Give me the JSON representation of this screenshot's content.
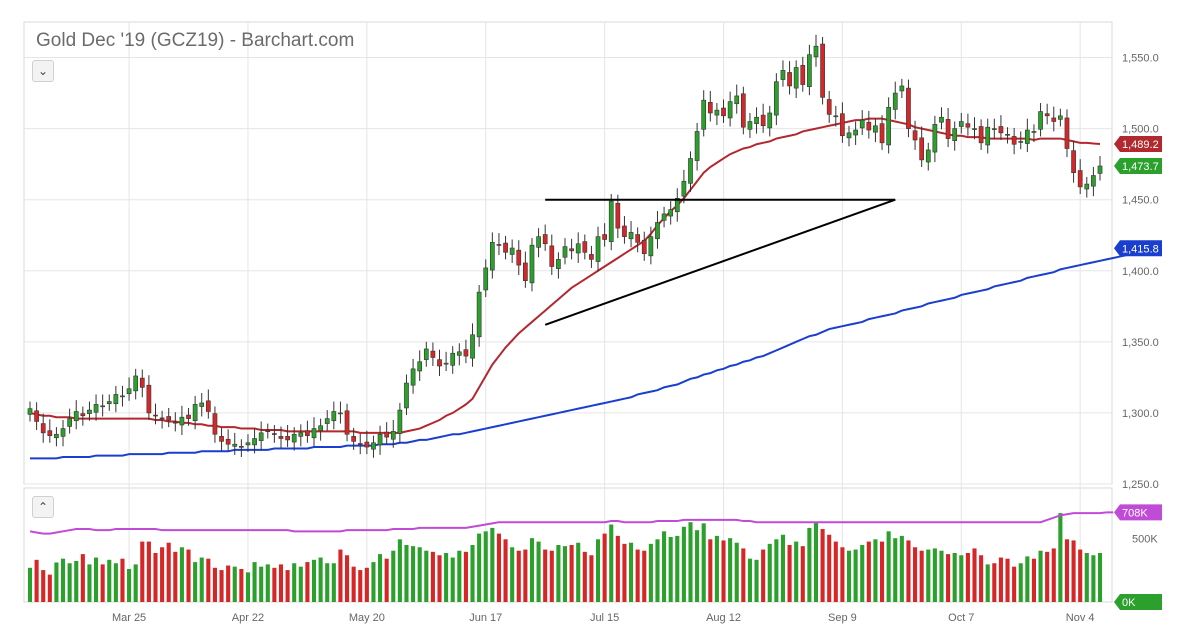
{
  "title": "Gold Dec '19 (GCZ19) - Barchart.com",
  "colors": {
    "up": "#2ca02c",
    "down": "#d62728",
    "ma_red": "#b2282f",
    "ma_blue": "#1a3fcf",
    "vol_avg": "#c04bd6",
    "grid": "#e5e5e5"
  },
  "chart_data": [
    {
      "type": "candlestick",
      "title": "Gold Dec '19 (GCZ19) - Barchart.com",
      "x_tick_labels": [
        "Mar 25",
        "Apr 22",
        "May 20",
        "Jun 17",
        "Jul 15",
        "Aug 12",
        "Sep 9",
        "Oct 7",
        "Nov 4"
      ],
      "y_tick_labels": [
        "1,550.0",
        "1,500.0",
        "1,450.0",
        "1,400.0",
        "1,350.0",
        "1,300.0",
        "1,250.0"
      ],
      "ylim": [
        1250,
        1575
      ],
      "grid": true,
      "price_badges": [
        {
          "label": "1,489.2",
          "value": 1489.2,
          "color": "#b2282f"
        },
        {
          "label": "1,473.7",
          "value": 1473.7,
          "color": "#2ca02c"
        },
        {
          "label": "1,415.8",
          "value": 1415.8,
          "color": "#1a3fcf"
        }
      ],
      "closes": [
        1303,
        1294,
        1286,
        1284,
        1285,
        1289,
        1296,
        1301,
        1298,
        1302,
        1306,
        1305,
        1308,
        1313,
        1312,
        1317,
        1326,
        1318,
        1300,
        1298,
        1296,
        1295,
        1293,
        1297,
        1296,
        1306,
        1307,
        1301,
        1285,
        1280,
        1278,
        1278,
        1276,
        1279,
        1282,
        1286,
        1287,
        1285,
        1282,
        1281,
        1285,
        1286,
        1284,
        1289,
        1291,
        1296,
        1301,
        1300,
        1285,
        1280,
        1278,
        1276,
        1279,
        1285,
        1283,
        1287,
        1302,
        1321,
        1331,
        1336,
        1345,
        1339,
        1333,
        1335,
        1342,
        1343,
        1340,
        1355,
        1385,
        1402,
        1420,
        1418,
        1413,
        1416,
        1404,
        1393,
        1418,
        1424,
        1419,
        1403,
        1408,
        1417,
        1414,
        1419,
        1413,
        1408,
        1424,
        1422,
        1449,
        1430,
        1424,
        1427,
        1420,
        1412,
        1424,
        1434,
        1440,
        1443,
        1451,
        1463,
        1479,
        1498,
        1520,
        1511,
        1513,
        1509,
        1519,
        1523,
        1501,
        1505,
        1508,
        1502,
        1511,
        1533,
        1541,
        1530,
        1543,
        1531,
        1552,
        1558,
        1522,
        1510,
        1509,
        1495,
        1497,
        1499,
        1506,
        1499,
        1502,
        1490,
        1515,
        1525,
        1530,
        1500,
        1492,
        1478,
        1485,
        1503,
        1508,
        1493,
        1500,
        1505,
        1501,
        1500,
        1490,
        1501,
        1500,
        1497,
        1496,
        1489,
        1491,
        1499,
        1498,
        1512,
        1509,
        1505,
        1509,
        1486,
        1469,
        1459,
        1461,
        1467,
        1473.7
      ],
      "ma_50": [
        1300,
        1299,
        1298,
        1298,
        1297,
        1297,
        1297,
        1296,
        1296,
        1296,
        1296,
        1296,
        1296,
        1296,
        1296,
        1296,
        1296,
        1296,
        1296,
        1295,
        1295,
        1294,
        1294,
        1293,
        1293,
        1292,
        1292,
        1291,
        1291,
        1290,
        1290,
        1290,
        1289,
        1289,
        1289,
        1288,
        1288,
        1288,
        1288,
        1287,
        1287,
        1287,
        1287,
        1287,
        1287,
        1287,
        1287,
        1287,
        1287,
        1287,
        1286,
        1286,
        1286,
        1286,
        1286,
        1286,
        1286,
        1287,
        1288,
        1289,
        1291,
        1293,
        1295,
        1298,
        1300,
        1303,
        1306,
        1310,
        1318,
        1326,
        1334,
        1340,
        1346,
        1351,
        1356,
        1360,
        1364,
        1368,
        1372,
        1376,
        1380,
        1384,
        1388,
        1391,
        1394,
        1397,
        1400,
        1403,
        1406,
        1409,
        1412,
        1415,
        1418,
        1421,
        1426,
        1432,
        1437,
        1442,
        1446,
        1451,
        1457,
        1463,
        1469,
        1473,
        1476,
        1479,
        1482,
        1484,
        1486,
        1487,
        1489,
        1490,
        1491,
        1493,
        1494,
        1495,
        1496,
        1498,
        1499,
        1500,
        1501,
        1502,
        1503,
        1504,
        1505,
        1506,
        1506,
        1507,
        1507,
        1507,
        1506,
        1505,
        1504,
        1503,
        1501,
        1500,
        1499,
        1498,
        1497,
        1496,
        1495,
        1495,
        1494,
        1494,
        1494,
        1493,
        1493,
        1493,
        1493,
        1493,
        1493,
        1493,
        1492,
        1493,
        1493,
        1493,
        1493,
        1492,
        1491,
        1490,
        1490,
        1489.5,
        1489.2
      ],
      "ma_200": [
        1268,
        1268,
        1268,
        1268,
        1268,
        1269,
        1269,
        1269,
        1269,
        1269,
        1270,
        1270,
        1270,
        1270,
        1270,
        1271,
        1271,
        1271,
        1271,
        1271,
        1271,
        1272,
        1272,
        1272,
        1272,
        1272,
        1273,
        1273,
        1273,
        1273,
        1273,
        1274,
        1274,
        1274,
        1274,
        1274,
        1274,
        1275,
        1275,
        1275,
        1275,
        1275,
        1275,
        1276,
        1276,
        1276,
        1276,
        1276,
        1277,
        1277,
        1277,
        1277,
        1277,
        1278,
        1278,
        1278,
        1279,
        1279,
        1280,
        1281,
        1281,
        1282,
        1283,
        1284,
        1285,
        1285,
        1286,
        1287,
        1288,
        1289,
        1290,
        1291,
        1292,
        1293,
        1294,
        1295,
        1296,
        1297,
        1298,
        1299,
        1300,
        1301,
        1302,
        1303,
        1304,
        1305,
        1306,
        1307,
        1308,
        1309,
        1310,
        1311,
        1313,
        1314,
        1315,
        1316,
        1318,
        1319,
        1320,
        1322,
        1324,
        1325,
        1327,
        1328,
        1330,
        1331,
        1333,
        1334,
        1336,
        1337,
        1339,
        1340,
        1342,
        1344,
        1346,
        1348,
        1350,
        1352,
        1354,
        1355,
        1357,
        1359,
        1360,
        1361,
        1362,
        1363,
        1364,
        1366,
        1367,
        1368,
        1369,
        1370,
        1372,
        1373,
        1374,
        1375,
        1377,
        1378,
        1379,
        1380,
        1381,
        1383,
        1384,
        1385,
        1386,
        1387,
        1389,
        1390,
        1391,
        1392,
        1393,
        1395,
        1396,
        1397,
        1398,
        1399,
        1401,
        1402,
        1403,
        1404,
        1405,
        1406,
        1407,
        1408,
        1409,
        1410,
        1411,
        1412,
        1413,
        1414,
        1415.8
      ],
      "annotations": [
        {
          "type": "horizontal-line",
          "from_index": 78,
          "to_index": 131,
          "value": 1450
        },
        {
          "type": "trend-line",
          "from_index": 78,
          "from_value": 1362,
          "to_index": 131,
          "to_value": 1450
        }
      ]
    },
    {
      "type": "bar",
      "title": "Volume",
      "ylim": [
        0,
        900000
      ],
      "y_tick_labels": [
        "500K"
      ],
      "avg_badge": {
        "label": "708K",
        "value": 708000,
        "color": "#c04bd6"
      },
      "zero_badge": {
        "label": "0K",
        "value": 0,
        "color": "#2ca02c"
      },
      "values": [
        270000,
        333000,
        252000,
        216000,
        312000,
        342000,
        306000,
        324000,
        378000,
        297000,
        351000,
        297000,
        333000,
        306000,
        342000,
        261000,
        297000,
        477000,
        477000,
        387000,
        432000,
        468000,
        396000,
        432000,
        414000,
        315000,
        351000,
        342000,
        270000,
        252000,
        288000,
        279000,
        261000,
        234000,
        315000,
        279000,
        297000,
        270000,
        297000,
        252000,
        306000,
        279000,
        315000,
        333000,
        351000,
        306000,
        306000,
        414000,
        369000,
        279000,
        252000,
        270000,
        315000,
        378000,
        342000,
        405000,
        495000,
        450000,
        441000,
        432000,
        405000,
        396000,
        369000,
        387000,
        351000,
        405000,
        396000,
        450000,
        540000,
        558000,
        585000,
        540000,
        495000,
        432000,
        405000,
        414000,
        504000,
        477000,
        414000,
        405000,
        450000,
        441000,
        450000,
        468000,
        396000,
        369000,
        495000,
        540000,
        612000,
        522000,
        459000,
        468000,
        414000,
        405000,
        459000,
        495000,
        558000,
        513000,
        522000,
        594000,
        630000,
        567000,
        621000,
        495000,
        522000,
        486000,
        504000,
        468000,
        423000,
        342000,
        333000,
        414000,
        459000,
        495000,
        531000,
        450000,
        477000,
        441000,
        585000,
        630000,
        576000,
        531000,
        477000,
        432000,
        405000,
        414000,
        450000,
        477000,
        495000,
        477000,
        558000,
        504000,
        522000,
        486000,
        432000,
        405000,
        414000,
        423000,
        405000,
        378000,
        387000,
        369000,
        387000,
        423000,
        369000,
        297000,
        306000,
        351000,
        342000,
        279000,
        306000,
        360000,
        342000,
        405000,
        396000,
        423000,
        702000,
        495000,
        486000,
        414000,
        387000,
        369000,
        387000
      ],
      "avg_values": [
        558000,
        549000,
        540000,
        540000,
        549000,
        558000,
        567000,
        576000,
        576000,
        576000,
        567000,
        567000,
        567000,
        576000,
        576000,
        576000,
        576000,
        576000,
        576000,
        576000,
        567000,
        567000,
        567000,
        567000,
        567000,
        567000,
        567000,
        567000,
        567000,
        567000,
        567000,
        567000,
        567000,
        567000,
        567000,
        567000,
        567000,
        567000,
        567000,
        567000,
        558000,
        558000,
        558000,
        558000,
        558000,
        558000,
        558000,
        558000,
        567000,
        567000,
        567000,
        567000,
        567000,
        567000,
        567000,
        576000,
        576000,
        576000,
        576000,
        585000,
        585000,
        585000,
        585000,
        585000,
        585000,
        585000,
        585000,
        594000,
        603000,
        612000,
        621000,
        630000,
        630000,
        630000,
        630000,
        630000,
        630000,
        630000,
        630000,
        630000,
        630000,
        630000,
        630000,
        630000,
        630000,
        630000,
        630000,
        630000,
        639000,
        639000,
        630000,
        630000,
        630000,
        630000,
        630000,
        639000,
        639000,
        639000,
        639000,
        648000,
        648000,
        648000,
        648000,
        648000,
        648000,
        648000,
        648000,
        648000,
        639000,
        639000,
        630000,
        630000,
        630000,
        630000,
        630000,
        630000,
        630000,
        630000,
        630000,
        630000,
        630000,
        630000,
        630000,
        630000,
        630000,
        630000,
        630000,
        630000,
        630000,
        630000,
        630000,
        630000,
        630000,
        630000,
        630000,
        630000,
        630000,
        630000,
        630000,
        630000,
        630000,
        630000,
        630000,
        630000,
        630000,
        630000,
        630000,
        630000,
        630000,
        630000,
        630000,
        630000,
        630000,
        630000,
        648000,
        666000,
        684000,
        693000,
        702000,
        702000,
        702000,
        702000,
        702000,
        708000,
        708000
      ]
    }
  ]
}
